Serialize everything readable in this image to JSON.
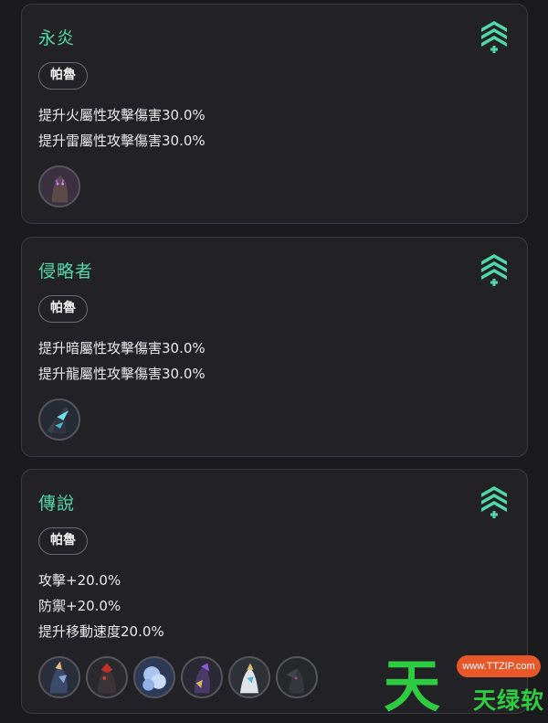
{
  "cards": [
    {
      "title": "永炎",
      "tag": "帕魯",
      "lines": [
        "提升火屬性攻擊傷害30.0%",
        "提升雷屬性攻擊傷害30.0%"
      ],
      "rank_icon": "rank-up-chevrons-icon",
      "avatars": [
        "pal-avatar-1"
      ]
    },
    {
      "title": "侵略者",
      "tag": "帕魯",
      "lines": [
        "提升暗屬性攻擊傷害30.0%",
        "提升龍屬性攻擊傷害30.0%"
      ],
      "rank_icon": "rank-up-chevrons-icon",
      "avatars": [
        "pal-avatar-1"
      ]
    },
    {
      "title": "傳說",
      "tag": "帕魯",
      "lines": [
        "攻擊+20.0%",
        "防禦+20.0%",
        "提升移動速度20.0%"
      ],
      "rank_icon": "rank-up-chevrons-icon",
      "avatars": [
        "pal-avatar-1",
        "pal-avatar-2",
        "pal-avatar-3",
        "pal-avatar-4",
        "pal-avatar-5",
        "pal-avatar-6"
      ]
    }
  ],
  "watermark": {
    "big": "天",
    "small": "天绿软",
    "url": "www.TTZIP.com"
  },
  "colors": {
    "background": "#1a1a1c",
    "card": "#222226",
    "title_accent": "#4fd8b0",
    "watermark_green": "#2ecc40",
    "watermark_orange": "#e8572a"
  }
}
